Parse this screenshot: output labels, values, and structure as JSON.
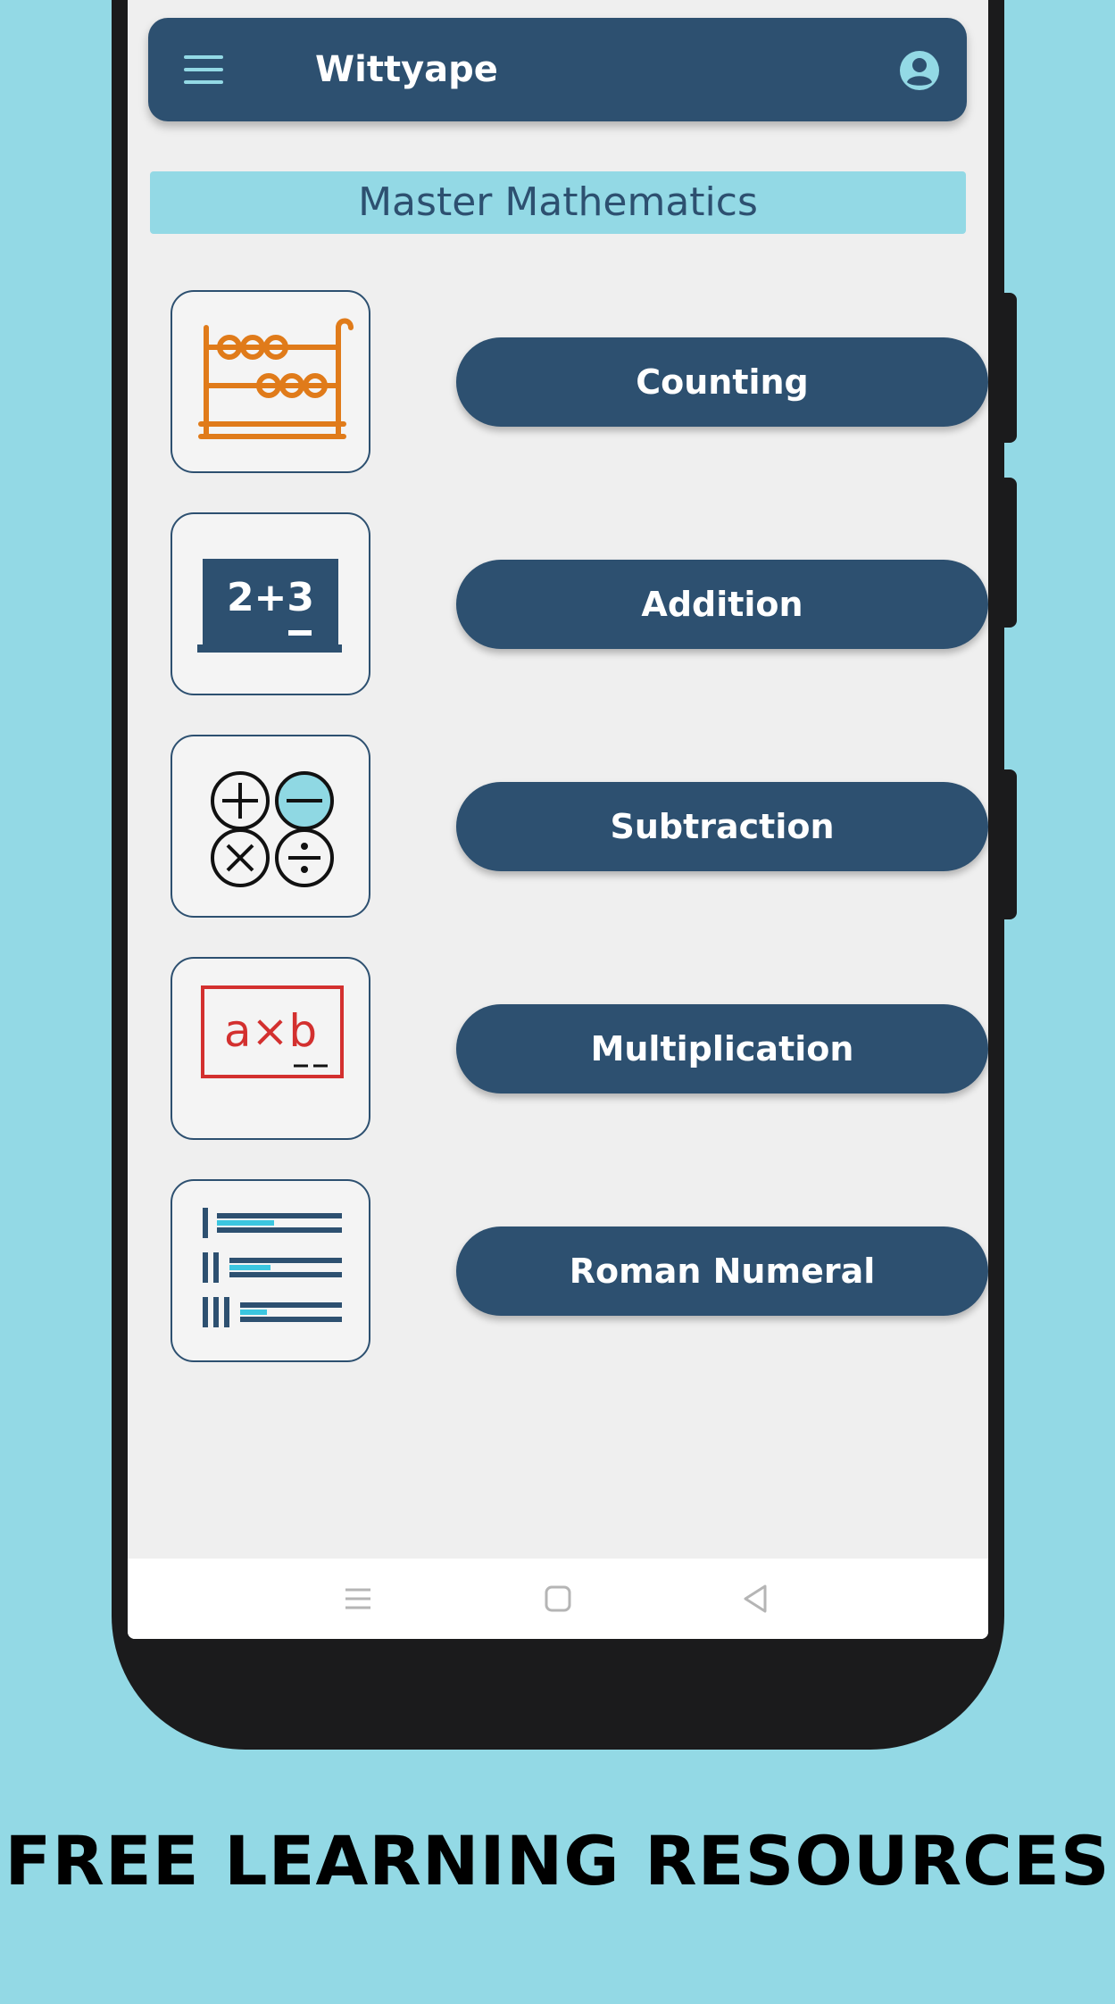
{
  "app_bar": {
    "title": "Wittyape",
    "menu_icon": "hamburger-menu-icon",
    "account_icon": "account-circle-icon"
  },
  "banner": {
    "title": "Master Mathematics"
  },
  "topics": [
    {
      "label": "Counting",
      "icon": "abacus-icon"
    },
    {
      "label": "Addition",
      "icon": "chalkboard-icon",
      "icon_text": "2+3"
    },
    {
      "label": "Subtraction",
      "icon": "math-operators-icon"
    },
    {
      "label": "Multiplication",
      "icon": "axb-board-icon",
      "icon_text": "a×b"
    },
    {
      "label": "Roman Numeral",
      "icon": "roman-numeral-list-icon"
    }
  ],
  "nav_bar": {
    "recents_icon": "recents-icon",
    "home_icon": "home-icon",
    "back_icon": "back-icon"
  },
  "caption": "FREE LEARNING RESOURCES",
  "colors": {
    "background": "#93d9e5",
    "primary": "#2d5070",
    "screen": "#efefef",
    "abacus": "#e07b1a",
    "board_red": "#d3302f",
    "accent_cyan": "#3bc6e0"
  }
}
